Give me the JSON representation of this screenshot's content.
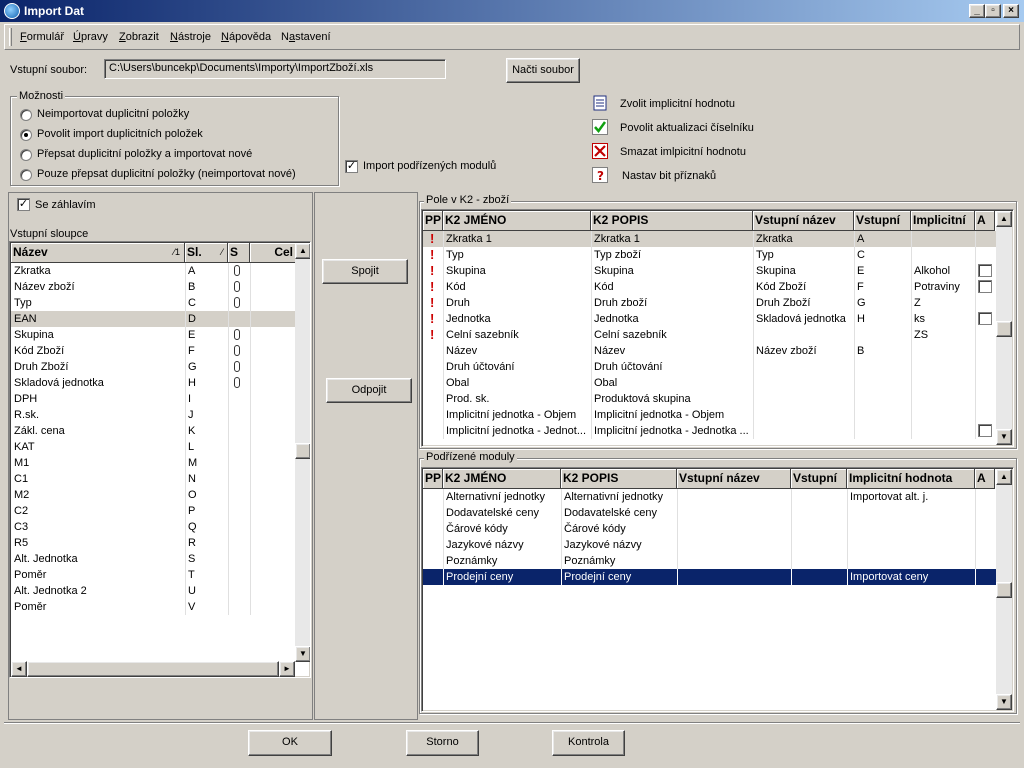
{
  "window": {
    "title": "Import Dat"
  },
  "menu": [
    "Formulář",
    "Úpravy",
    "Zobrazit",
    "Nástroje",
    "Nápověda",
    "Nastavení"
  ],
  "input_file": {
    "label": "Vstupní soubor:",
    "value": "C:\\Users\\buncekp\\Documents\\Importy\\ImportZboží.xls",
    "load_button": "Načti soubor"
  },
  "options": {
    "legend": "Možnosti",
    "radios": [
      "Neimportovat duplicitní položky",
      "Povolit import duplicitních položek",
      "Přepsat duplicitní položky a importovat nové",
      "Pouze přepsat duplicitní položky (neimportovat nové)"
    ],
    "selected_index": 1
  },
  "import_submodules": {
    "label": "Import podřízených modulů",
    "checked": true
  },
  "actions": [
    {
      "icon": "list-icon",
      "label": "Zvolit implicitní hodnotu"
    },
    {
      "icon": "checkmark-icon",
      "label": "Povolit aktualizaci číselníku"
    },
    {
      "icon": "delete-x-icon",
      "label": "Smazat imlpicitní hodnotu"
    },
    {
      "icon": "question-icon",
      "label": "Nastav bit příznaků"
    }
  ],
  "header_checkbox": {
    "label": "Se záhlavím",
    "checked": true
  },
  "input_columns": {
    "title": "Vstupní sloupce",
    "headers": [
      "Název",
      "Sl.",
      "S",
      "Cel"
    ],
    "rows": [
      {
        "name": "Zkratka",
        "col": "A",
        "s": true
      },
      {
        "name": "Název zboží",
        "col": "B",
        "s": true
      },
      {
        "name": "Typ",
        "col": "C",
        "s": true
      },
      {
        "name": "EAN",
        "col": "D",
        "s": false,
        "highlight": true
      },
      {
        "name": "Skupina",
        "col": "E",
        "s": true
      },
      {
        "name": "Kód Zboží",
        "col": "F",
        "s": true
      },
      {
        "name": "Druh Zboží",
        "col": "G",
        "s": true
      },
      {
        "name": "Skladová jednotka",
        "col": "H",
        "s": true
      },
      {
        "name": "DPH",
        "col": "I",
        "s": false
      },
      {
        "name": "R.sk.",
        "col": "J",
        "s": false
      },
      {
        "name": "Zákl. cena",
        "col": "K",
        "s": false
      },
      {
        "name": "KAT",
        "col": "L",
        "s": false
      },
      {
        "name": "M1",
        "col": "M",
        "s": false
      },
      {
        "name": "C1",
        "col": "N",
        "s": false
      },
      {
        "name": "M2",
        "col": "O",
        "s": false
      },
      {
        "name": "C2",
        "col": "P",
        "s": false
      },
      {
        "name": "C3",
        "col": "Q",
        "s": false
      },
      {
        "name": "R5",
        "col": "R",
        "s": false
      },
      {
        "name": "Alt. Jednotka",
        "col": "S",
        "s": false
      },
      {
        "name": "Poměr",
        "col": "T",
        "s": false
      },
      {
        "name": "Alt. Jednotka 2",
        "col": "U",
        "s": false
      },
      {
        "name": "Poměr",
        "col": "V",
        "s": false
      }
    ]
  },
  "middle_buttons": {
    "connect": "Spojit",
    "disconnect": "Odpojit"
  },
  "k2_fields": {
    "legend": "Pole v K2 - zboží",
    "headers": [
      "PP",
      "K2 JMÉNO",
      "K2 POPIS",
      "Vstupní název",
      "Vstupní",
      "Implicitní",
      "A"
    ],
    "rows": [
      {
        "req": true,
        "name": "Zkratka 1",
        "desc": "Zkratka 1",
        "in_name": "Zkratka",
        "in_col": "A",
        "impl": "",
        "chk": false,
        "selected": true
      },
      {
        "req": true,
        "name": "Typ",
        "desc": "Typ zboží",
        "in_name": "Typ",
        "in_col": "C",
        "impl": "",
        "chk": false
      },
      {
        "req": true,
        "name": "Skupina",
        "desc": "Skupina",
        "in_name": "Skupina",
        "in_col": "E",
        "impl": "Alkohol",
        "chk": true
      },
      {
        "req": true,
        "name": "Kód",
        "desc": "Kód",
        "in_name": "Kód Zboží",
        "in_col": "F",
        "impl": "Potraviny",
        "chk": true
      },
      {
        "req": true,
        "name": "Druh",
        "desc": "Druh zboží",
        "in_name": "Druh Zboží",
        "in_col": "G",
        "impl": "Z",
        "chk": false
      },
      {
        "req": true,
        "name": "Jednotka",
        "desc": "Jednotka",
        "in_name": "Skladová jednotka",
        "in_col": "H",
        "impl": "ks",
        "chk": true
      },
      {
        "req": true,
        "name": "Celní sazebník",
        "desc": "Celní sazebník",
        "in_name": "",
        "in_col": "",
        "impl": "ZS",
        "chk": false
      },
      {
        "req": false,
        "name": "Název",
        "desc": "Název",
        "in_name": "Název zboží",
        "in_col": "B",
        "impl": "",
        "chk": false
      },
      {
        "req": false,
        "name": "Druh účtování",
        "desc": "Druh účtování",
        "in_name": "",
        "in_col": "",
        "impl": "",
        "chk": false
      },
      {
        "req": false,
        "name": "Obal",
        "desc": "Obal",
        "in_name": "",
        "in_col": "",
        "impl": "",
        "chk": false
      },
      {
        "req": false,
        "name": "Prod. sk.",
        "desc": "Produktová skupina",
        "in_name": "",
        "in_col": "",
        "impl": "",
        "chk": false
      },
      {
        "req": false,
        "name": "Implicitní jednotka - Objem",
        "desc": "Implicitní jednotka - Objem",
        "in_name": "",
        "in_col": "",
        "impl": "",
        "chk": false
      },
      {
        "req": false,
        "name": "Implicitní jednotka - Jednot...",
        "desc": "Implicitní jednotka - Jednotka ...",
        "in_name": "",
        "in_col": "",
        "impl": "",
        "chk": true
      }
    ]
  },
  "submodules": {
    "legend": "Podřízené moduly",
    "headers": [
      "PP",
      "K2 JMÉNO",
      "K2 POPIS",
      "Vstupní název",
      "Vstupní",
      "Implicitní hodnota",
      "A"
    ],
    "rows": [
      {
        "name": "Alternativní jednotky",
        "desc": "Alternativní jednotky",
        "impl": "Importovat alt. j.",
        "selected": false
      },
      {
        "name": "Dodavatelské ceny",
        "desc": "Dodavatelské ceny",
        "impl": "",
        "selected": false
      },
      {
        "name": "Čárové kódy",
        "desc": "Čárové kódy",
        "impl": "",
        "selected": false
      },
      {
        "name": "Jazykové názvy",
        "desc": "Jazykové názvy",
        "impl": "",
        "selected": false
      },
      {
        "name": "Poznámky",
        "desc": "Poznámky",
        "impl": "",
        "selected": false
      },
      {
        "name": "Prodejní ceny",
        "desc": "Prodejní ceny",
        "impl": "Importovat ceny",
        "selected": true
      }
    ]
  },
  "bottom_buttons": [
    "OK",
    "Storno",
    "Kontrola"
  ],
  "colors": {
    "selection": "#0a246a",
    "required": "#cc0000",
    "title_start": "#0a246a",
    "title_end": "#a6caf0"
  }
}
